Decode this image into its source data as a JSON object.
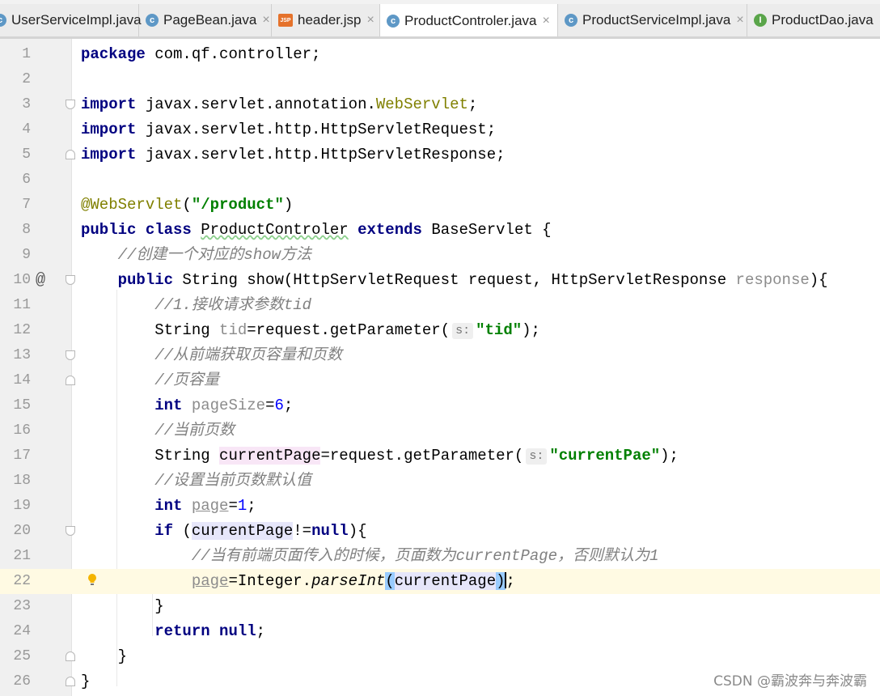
{
  "tabs": [
    {
      "label": "UserServiceImpl.java",
      "icon": "class-icon"
    },
    {
      "label": "PageBean.java",
      "icon": "class-icon"
    },
    {
      "label": "header.jsp",
      "icon": "jsp-icon"
    },
    {
      "label": "ProductControler.java",
      "icon": "class-icon"
    },
    {
      "label": "ProductServiceImpl.java",
      "icon": "class-icon"
    },
    {
      "label": "ProductDao.java",
      "icon": "interface-icon"
    }
  ],
  "tab_close_glyph": "×",
  "icon_letters": {
    "class": "c",
    "interface": "I",
    "jsp": "JSP"
  },
  "line_numbers": [
    "1",
    "2",
    "3",
    "4",
    "5",
    "6",
    "7",
    "8",
    "9",
    "10",
    "11",
    "12",
    "13",
    "14",
    "15",
    "16",
    "17",
    "18",
    "19",
    "20",
    "21",
    "22",
    "23",
    "24",
    "25",
    "26"
  ],
  "gutter": {
    "override_marker": "@"
  },
  "code": {
    "l1_kw": "package",
    "l1_rest": " com.qf.controller;",
    "l3_kw": "import",
    "l3_a": " javax.servlet.annotation.",
    "l3_ann": "WebServlet",
    "l3_end": ";",
    "l4_kw": "import",
    "l4_rest": " javax.servlet.http.HttpServletRequest;",
    "l5_kw": "import",
    "l5_rest": " javax.servlet.http.HttpServletResponse;",
    "l7_ann": "@WebServlet",
    "l7_open": "(",
    "l7_str": "\"/product\"",
    "l7_close": ")",
    "l8_kw1": "public",
    "l8_kw2": "class",
    "l8_name": "ProductControler",
    "l8_kw3": "extends",
    "l8_rest": " BaseServlet {",
    "l9_cmt": "//创建一个对应的show方法",
    "l10_kw": "public",
    "l10_a": " String show(HttpServletRequest request, HttpServletResponse ",
    "l10_unused": "response",
    "l10_end": "){",
    "l11_cmt": "//1.接收请求参数tid",
    "l12_a": "String ",
    "l12_var": "tid",
    "l12_b": "=request.getParameter(",
    "l12_hint": "s:",
    "l12_str": "\"tid\"",
    "l12_end": ");",
    "l13_cmt": "//从前端获取页容量和页数",
    "l14_cmt": "//页容量",
    "l15_kw": "int",
    "l15_var": "pageSize",
    "l15_eq": "=",
    "l15_num": "6",
    "l15_end": ";",
    "l16_cmt": "//当前页数",
    "l17_a": "String ",
    "l17_var": "currentPage",
    "l17_b": "=request.getParameter(",
    "l17_hint": "s:",
    "l17_str": "\"currentPae\"",
    "l17_end": ");",
    "l18_cmt": "//设置当前页数默认值",
    "l19_kw": "int",
    "l19_var": "page",
    "l19_eq": "=",
    "l19_num": "1",
    "l19_end": ";",
    "l20_kw": "if",
    "l20_a": "(",
    "l20_var": "currentPage",
    "l20_b": "!=",
    "l20_kw2": "null",
    "l20_end": "){",
    "l21_cmt": "//当有前端页面传入的时候，页面数为currentPage，否则默认为1",
    "l22_var": "page",
    "l22_a": "=Integer.",
    "l22_static": "parseInt",
    "l22_open": "(",
    "l22_arg": "currentPage",
    "l22_close": ")",
    "l22_end": ";",
    "l23": "}",
    "l24_kw": "return",
    "l24_kw2": "null",
    "l24_end": ";",
    "l25": "}",
    "l26": "}"
  },
  "watermark": "CSDN @霸波奔与奔波霸",
  "colors": {
    "keyword": "#000080",
    "annotation": "#808000",
    "string": "#008000",
    "number": "#0000ff",
    "comment": "#808080",
    "current_line": "#fffae3"
  }
}
